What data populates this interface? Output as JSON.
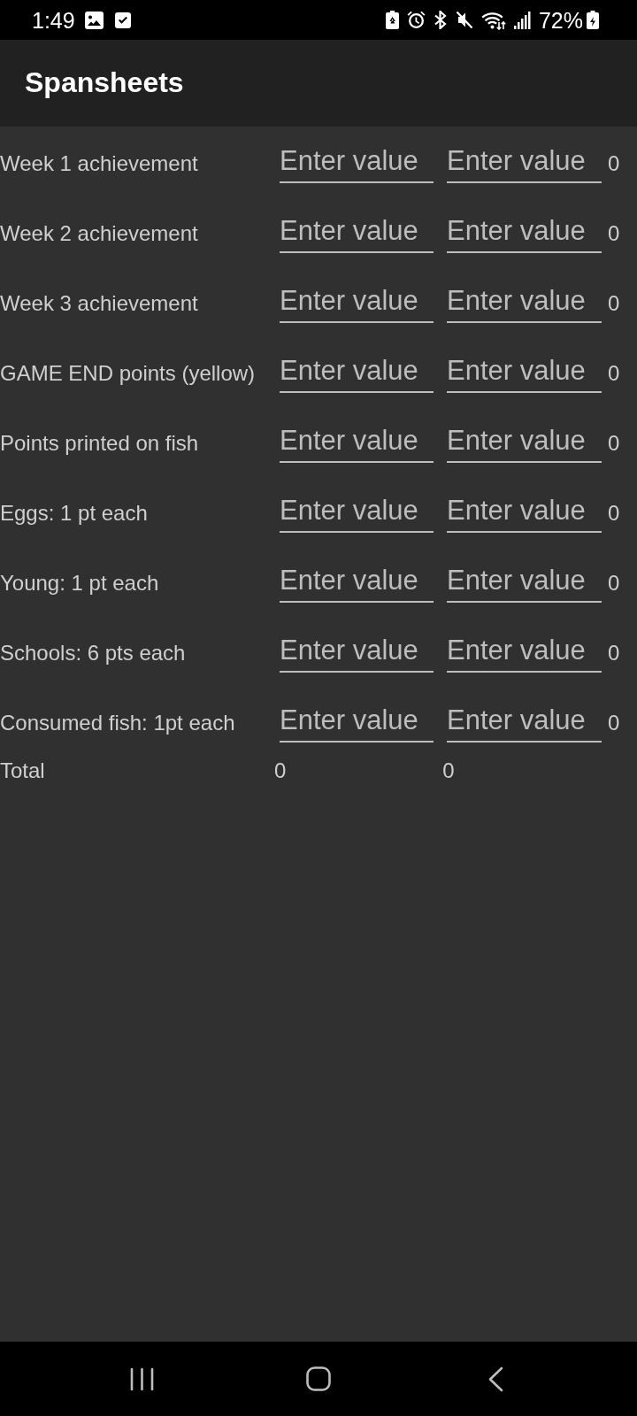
{
  "status_bar": {
    "time": "1:49",
    "battery_percent": "72%"
  },
  "app_bar": {
    "title": "Spansheets"
  },
  "rows": [
    {
      "label": "Week 1 achievement",
      "inputs": [
        {
          "placeholder": "Enter value"
        },
        {
          "placeholder": "Enter value"
        }
      ],
      "result": "0"
    },
    {
      "label": "Week 2 achievement",
      "inputs": [
        {
          "placeholder": "Enter value"
        },
        {
          "placeholder": "Enter value"
        }
      ],
      "result": "0"
    },
    {
      "label": "Week 3 achievement",
      "inputs": [
        {
          "placeholder": "Enter value"
        },
        {
          "placeholder": "Enter value"
        }
      ],
      "result": "0"
    },
    {
      "label": "GAME END points (yellow)",
      "inputs": [
        {
          "placeholder": "Enter value"
        },
        {
          "placeholder": "Enter value"
        }
      ],
      "result": "0"
    },
    {
      "label": "Points printed on fish",
      "inputs": [
        {
          "placeholder": "Enter value"
        },
        {
          "placeholder": "Enter value"
        }
      ],
      "result": "0"
    },
    {
      "label": "Eggs: 1 pt each",
      "inputs": [
        {
          "placeholder": "Enter value"
        },
        {
          "placeholder": "Enter value"
        }
      ],
      "result": "0"
    },
    {
      "label": "Young: 1 pt each",
      "inputs": [
        {
          "placeholder": "Enter value"
        },
        {
          "placeholder": "Enter value"
        }
      ],
      "result": "0"
    },
    {
      "label": "Schools: 6 pts each",
      "inputs": [
        {
          "placeholder": "Enter value"
        },
        {
          "placeholder": "Enter value"
        }
      ],
      "result": "0"
    },
    {
      "label": "Consumed fish: 1pt each",
      "inputs": [
        {
          "placeholder": "Enter value"
        },
        {
          "placeholder": "Enter value"
        }
      ],
      "result": "0"
    }
  ],
  "total": {
    "label": "Total",
    "values": [
      "0",
      "0"
    ]
  }
}
